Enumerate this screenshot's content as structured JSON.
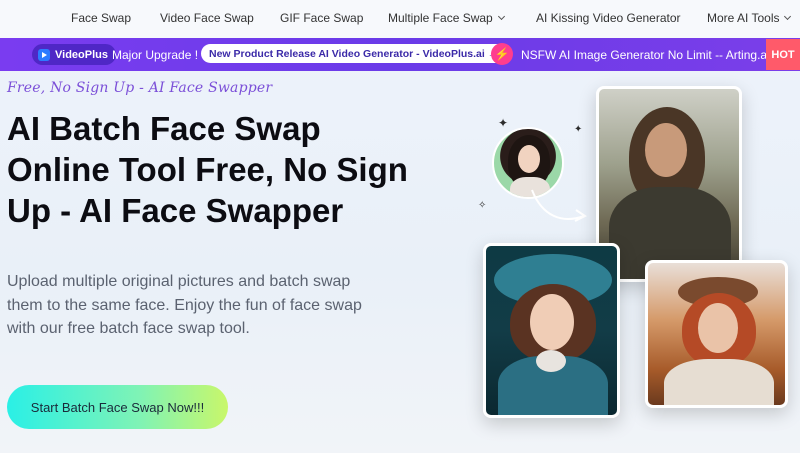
{
  "nav": {
    "items": [
      {
        "label": "Face Swap"
      },
      {
        "label": "Video Face Swap"
      },
      {
        "label": "GIF Face Swap"
      },
      {
        "label": "Multiple Face Swap"
      },
      {
        "label": "AI Kissing Video Generator"
      },
      {
        "label": "More AI Tools"
      }
    ]
  },
  "promo": {
    "brand": "VideoPlus",
    "upgrade_text": "Major Upgrade !",
    "release_link": "New Product Release AI Video Generator - VideoPlus.ai →",
    "nsfw_text": "NSFW AI Image Generator No Limit -- Arting.ai",
    "hot_badge": "HOT"
  },
  "hero": {
    "tagline": "Free, No Sign Up - AI Face Swapper",
    "headline": "AI Batch Face Swap Online Tool Free, No Sign Up - AI Face Swapper",
    "description": "Upload multiple original pictures and batch swap them to the same face. Enjoy the fun of face swap with our free batch face swap tool.",
    "cta_label": "Start Batch Face Swap Now!!!"
  },
  "colors": {
    "promo_bar": "#6a3be8",
    "tagline": "#7b4fd8",
    "hot_badge": "#ff5a6a",
    "cta_gradient_start": "#2af0e6",
    "cta_gradient_end": "#c9f76a"
  }
}
